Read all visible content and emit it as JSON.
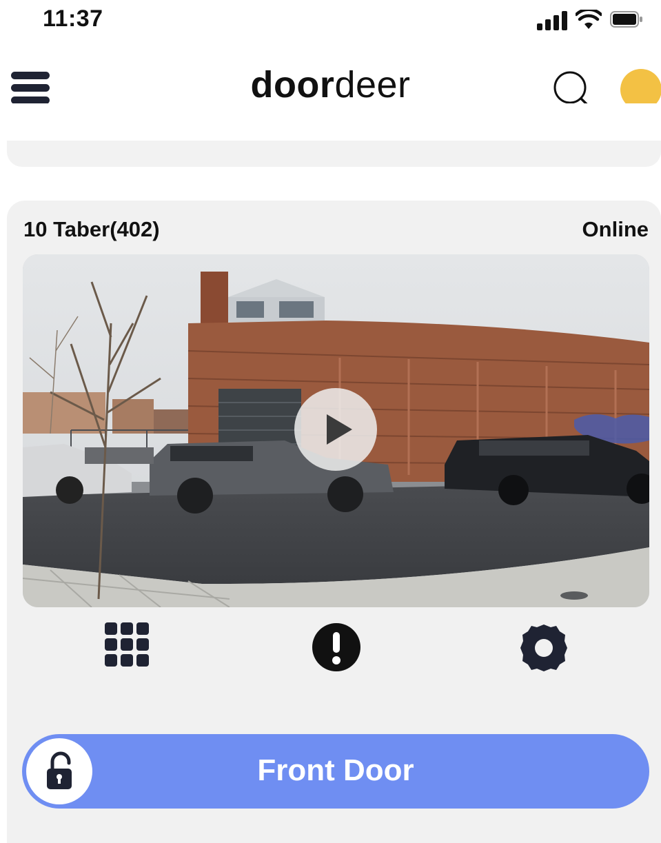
{
  "status_bar": {
    "time": "11:37",
    "icons": [
      "signal-icon",
      "wifi-icon",
      "battery-icon"
    ]
  },
  "header": {
    "logo_bold": "door",
    "logo_light": "deer",
    "menu_icon": "hamburger-menu-icon",
    "search_icon": "search-icon",
    "avatar_color": "#f3c144"
  },
  "camera": {
    "name": "10 Taber(402)",
    "status": "Online",
    "play_icon": "play-icon"
  },
  "actions": [
    {
      "icon": "keypad-icon"
    },
    {
      "icon": "alert-icon"
    },
    {
      "icon": "settings-gear-icon"
    }
  ],
  "unlock": {
    "label": "Front Door",
    "icon": "unlocked-padlock-icon",
    "color": "#6f8ef2"
  }
}
